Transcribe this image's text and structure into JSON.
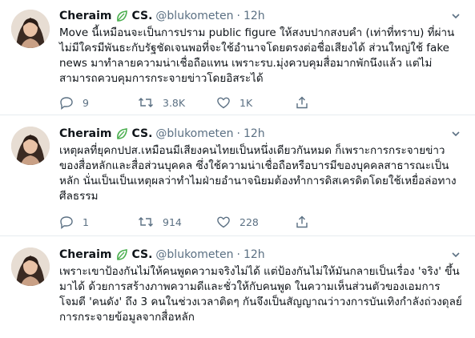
{
  "tweets": [
    {
      "display_name": "Cheraim",
      "badge": "CS.",
      "handle": "@blukometen",
      "separator": "·",
      "time": "12h",
      "text": "Move นี้เหมือนจะเป็นการปราม public figure ให้สงบปากสงบคำ (เท่าที่ทราบ) ที่ผ่านไม่มีใครมีพันธะกับรัฐชัดเจนพอที่จะใช้อำนาจโดยตรงต่อชื่อเสียงได้ ส่วนใหญ่ใช้ fake news มาทำลายความน่าเชื่อถือแทน เพราะรบ.มุ่งควบคุมสื่อมากพักนึงแล้ว แต่ไม่สามารถควบคุมการกระจายข่าวโดยอิสระได้",
      "replies": "9",
      "retweets": "3.8K",
      "likes": "1K"
    },
    {
      "display_name": "Cheraim",
      "badge": "CS.",
      "handle": "@blukometen",
      "separator": "·",
      "time": "12h",
      "text": "เหตุผลที่ยุคกปปส.เหมือนมีเสียงคนไทยเป็นหนึ่งเดียวกันหมด ก็เพราะการกระจายข่าวของสื่อหลักและสื่อส่วนบุคคล ซึ่งใช้ความน่าเชื่อถือหรือบารมีของบุคคลสาธารณะเป็นหลัก นั่นเป็นเป็นเหตุผลว่าทำไมฝ่ายอำนาจนิยมต้องทำการดิสเครดิตโดยใช้เหยื่อล่อทางศีลธรรม",
      "replies": "1",
      "retweets": "914",
      "likes": "228"
    },
    {
      "display_name": "Cheraim",
      "badge": "CS.",
      "handle": "@blukometen",
      "separator": "·",
      "time": "12h",
      "text": "เพราะเขาป้องกันไม่ให้คนพูดความจริงไม่ได้ แต่ป้องกันไม่ให้มันกลายเป็นเรื่อง 'จริง' ขึ้นมาได้ ด้วยการสร้างภาพความดีและชั่วให้กับคนพูด ในความเห็นส่วนตัวของเอมการโจมตี 'คนดัง' ถึง 3 คนในช่วงเวลาติดๆ กันจึงเป็นสัญญาณว่าวงการบันเทิงกำลังถ่วงดุลย์การกระจายข้อมูลจากสื่อหลัก"
    }
  ],
  "colors": {
    "text": "#0f1419",
    "muted": "#5b7083",
    "leaf": "#4caf50",
    "divider": "#e6ecf0"
  },
  "icons": [
    "avatar-photo",
    "leaf-icon",
    "chevron-down-icon",
    "reply-icon",
    "retweet-icon",
    "like-icon",
    "share-icon"
  ]
}
